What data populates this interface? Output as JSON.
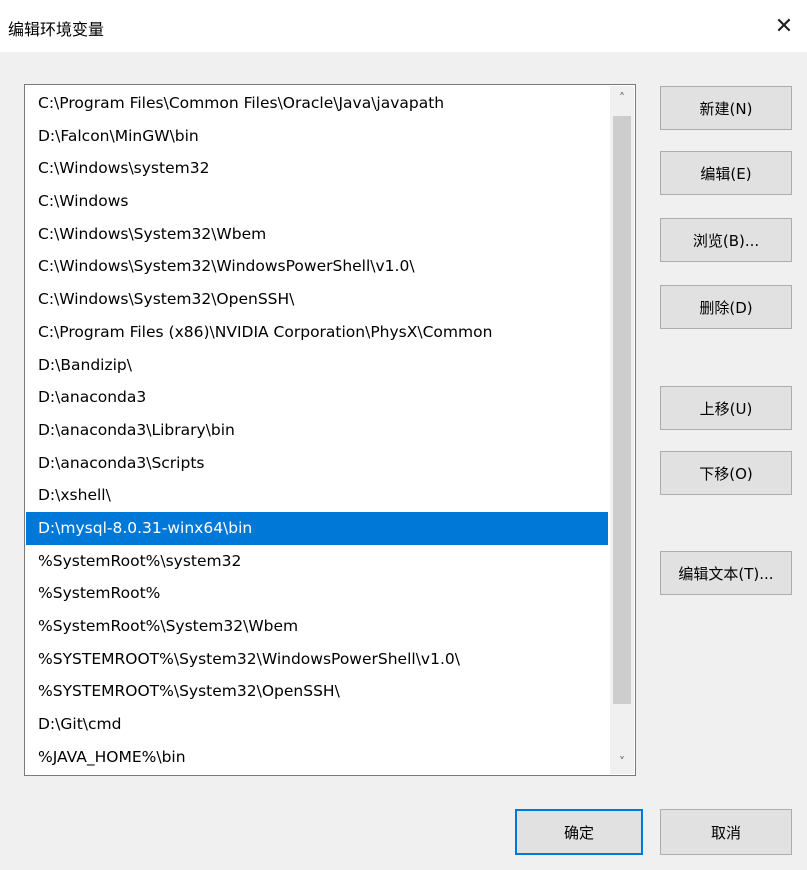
{
  "dialog": {
    "title": "编辑环境变量",
    "close": "✕"
  },
  "paths": [
    "C:\\Program Files\\Common Files\\Oracle\\Java\\javapath",
    "D:\\Falcon\\MinGW\\bin",
    "C:\\Windows\\system32",
    "C:\\Windows",
    "C:\\Windows\\System32\\Wbem",
    "C:\\Windows\\System32\\WindowsPowerShell\\v1.0\\",
    "C:\\Windows\\System32\\OpenSSH\\",
    "C:\\Program Files (x86)\\NVIDIA Corporation\\PhysX\\Common",
    "D:\\Bandizip\\",
    "D:\\anaconda3",
    "D:\\anaconda3\\Library\\bin",
    "D:\\anaconda3\\Scripts",
    "D:\\xshell\\",
    "D:\\mysql-8.0.31-winx64\\bin",
    "%SystemRoot%\\system32",
    "%SystemRoot%",
    "%SystemRoot%\\System32\\Wbem",
    "%SYSTEMROOT%\\System32\\WindowsPowerShell\\v1.0\\",
    "%SYSTEMROOT%\\System32\\OpenSSH\\",
    "D:\\Git\\cmd",
    "%JAVA_HOME%\\bin"
  ],
  "selected_index": 13,
  "scroll": {
    "up": "˄",
    "down": "˅"
  },
  "buttons": {
    "new": "新建(N)",
    "edit": "编辑(E)",
    "browse": "浏览(B)...",
    "delete": "删除(D)",
    "move_up": "上移(U)",
    "move_down": "下移(O)",
    "edit_text": "编辑文本(T)...",
    "ok": "确定",
    "cancel": "取消"
  },
  "colors": {
    "selection": "#0078d7",
    "default_button_border": "#0078d7"
  }
}
